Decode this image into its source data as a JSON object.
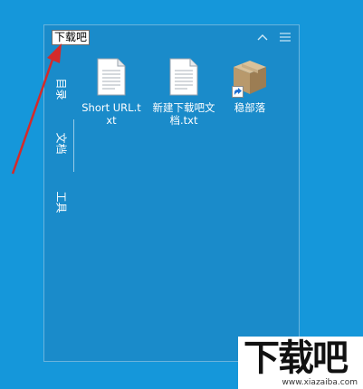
{
  "fence": {
    "title": "下载吧",
    "collapse_icon": "chevron-up-icon",
    "menu_icon": "menu-icon"
  },
  "sidebar": {
    "tabs": [
      {
        "label": "目录"
      },
      {
        "label": "文档"
      },
      {
        "label": "工具"
      }
    ]
  },
  "files": [
    {
      "label": "Short URL.txt",
      "icon": "text-document-icon"
    },
    {
      "label": "新建下载吧文档.txt",
      "icon": "text-document-icon"
    },
    {
      "label": "稳部落",
      "icon": "package-box-icon"
    }
  ],
  "watermark": {
    "logo": "下载吧",
    "url": "www.xiazaiba.com"
  },
  "colors": {
    "desktop": "#1597da",
    "fence": "#1a8bca",
    "annotation": "#d42a2a"
  }
}
